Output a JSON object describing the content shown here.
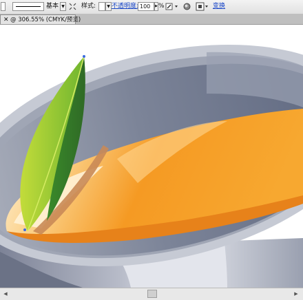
{
  "control_bar": {
    "stroke_profile_label": "基本",
    "style_label": "样式:",
    "opacity_label": "不透明度:",
    "opacity_value": "100",
    "percent_symbol": "%",
    "transform_label": "变换"
  },
  "document_tab": {
    "title": "@ 306.55% (CMYK/预览)"
  },
  "colors": {
    "accent_link": "#1a47c8",
    "bowl_rim": "#c6cad4",
    "bowl_dark": "#6f788e",
    "soup_orange": "#f39a1e",
    "leaf_green": "#5faa2c"
  }
}
